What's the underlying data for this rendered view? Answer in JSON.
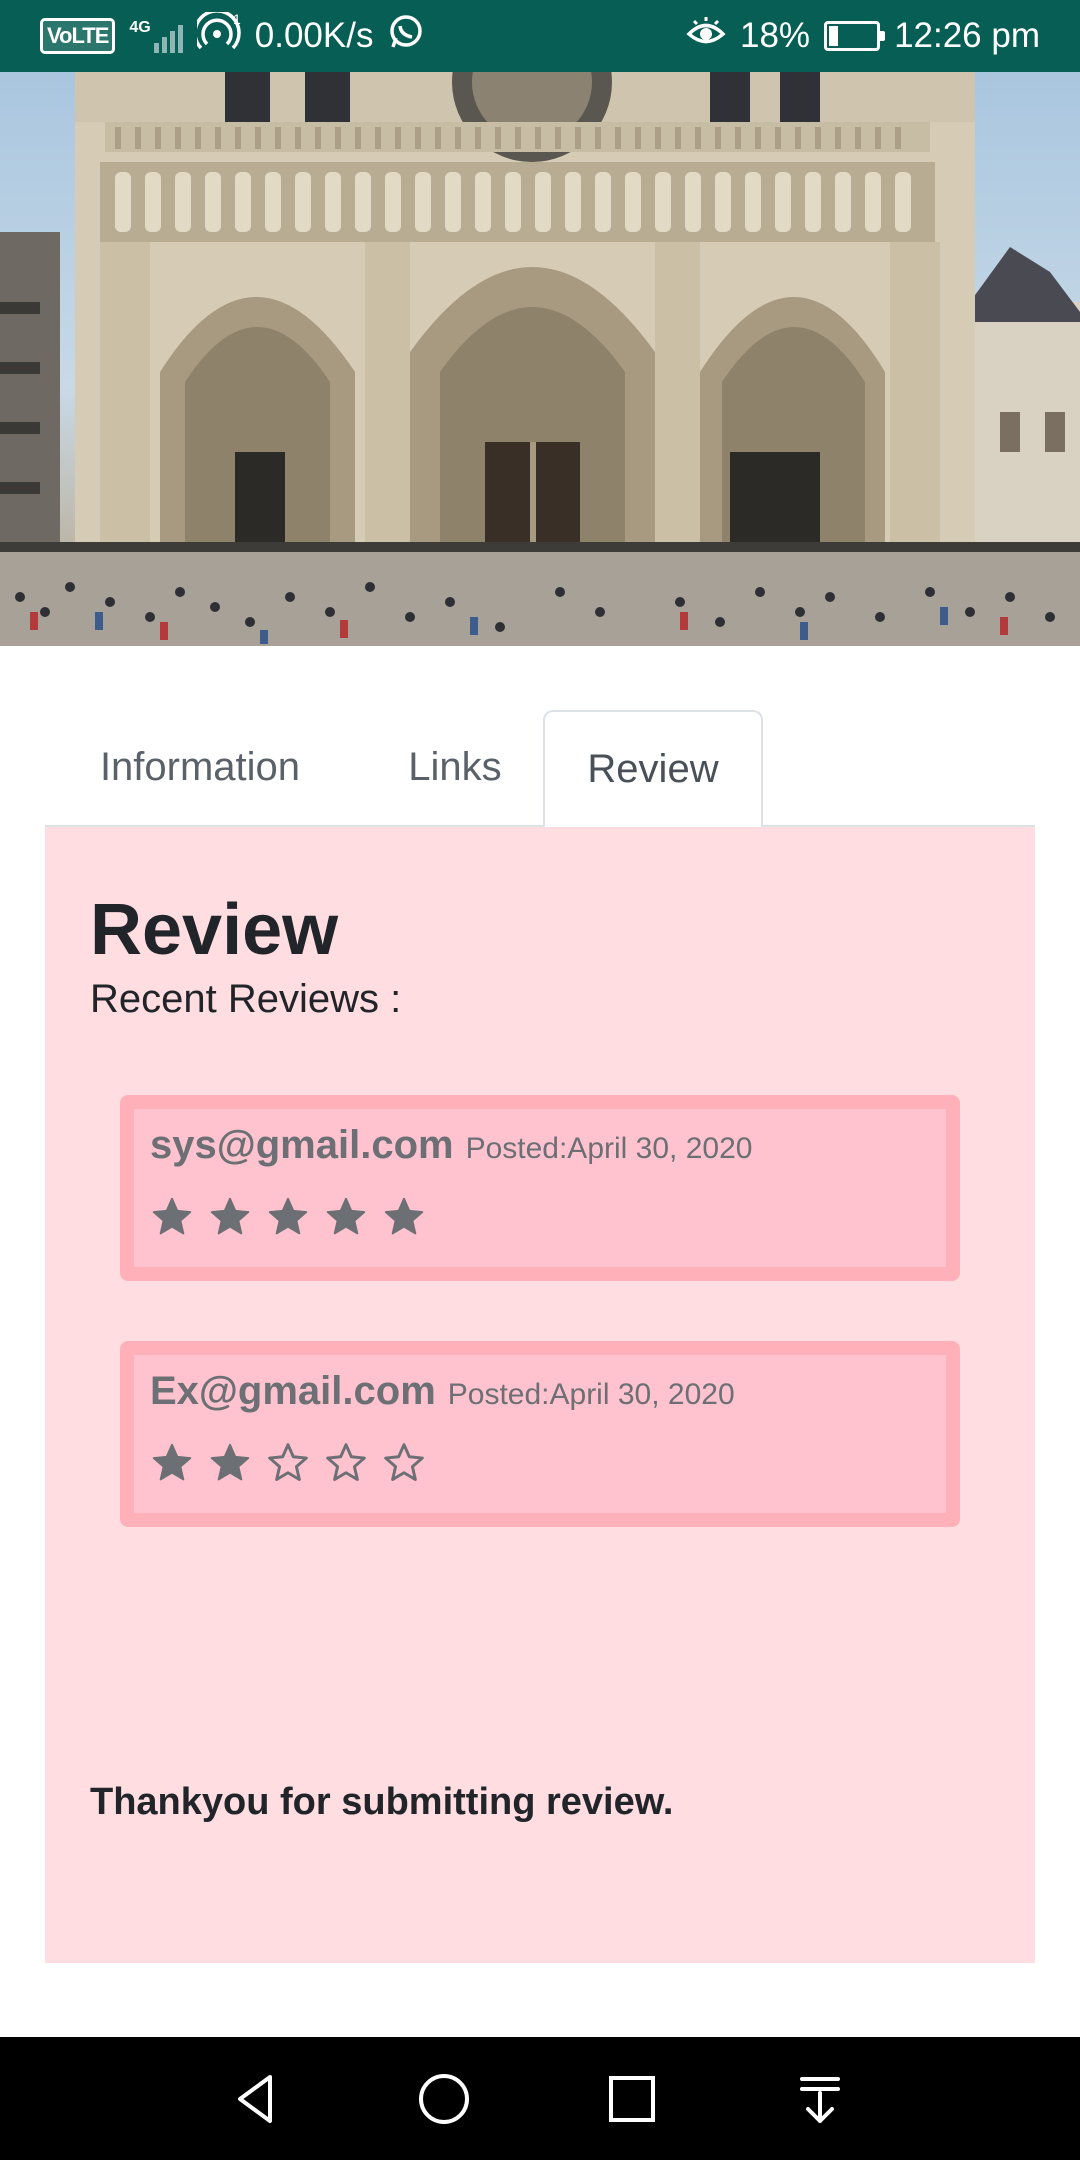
{
  "status_bar": {
    "network_speed": "0.00K/s",
    "battery_percent": "18%",
    "time": "12:26 pm",
    "volte_label": "VoLTE",
    "network_type": "4G",
    "battery_level": 0.18,
    "icons": [
      "volte-icon",
      "signal-icon",
      "hotspot-icon",
      "whatsapp-icon",
      "eye-icon",
      "battery-icon"
    ]
  },
  "hero": {
    "subject": "cathedral-facade-photo"
  },
  "tabs": [
    {
      "label": "Information",
      "active": false
    },
    {
      "label": "Links",
      "active": false
    },
    {
      "label": "Review",
      "active": true
    }
  ],
  "review_section": {
    "title": "Review",
    "subtitle": "Recent Reviews :",
    "reviews": [
      {
        "user": "sys@gmail.com",
        "posted": "Posted:April 30, 2020",
        "rating": 5,
        "max_rating": 5
      },
      {
        "user": "Ex@gmail.com",
        "posted": "Posted:April 30, 2020",
        "rating": 2,
        "max_rating": 5
      }
    ],
    "confirmation": "Thankyou for submitting review."
  },
  "colors": {
    "status_bar": "#075e54",
    "panel_bg": "#ffdde1",
    "card_border": "#ffb0b8",
    "card_bg": "#ffc3d0",
    "star": "#6c6f73"
  },
  "nav_bar": {
    "icons": [
      "back-icon",
      "home-icon",
      "recents-icon",
      "notification-pull-icon"
    ]
  }
}
